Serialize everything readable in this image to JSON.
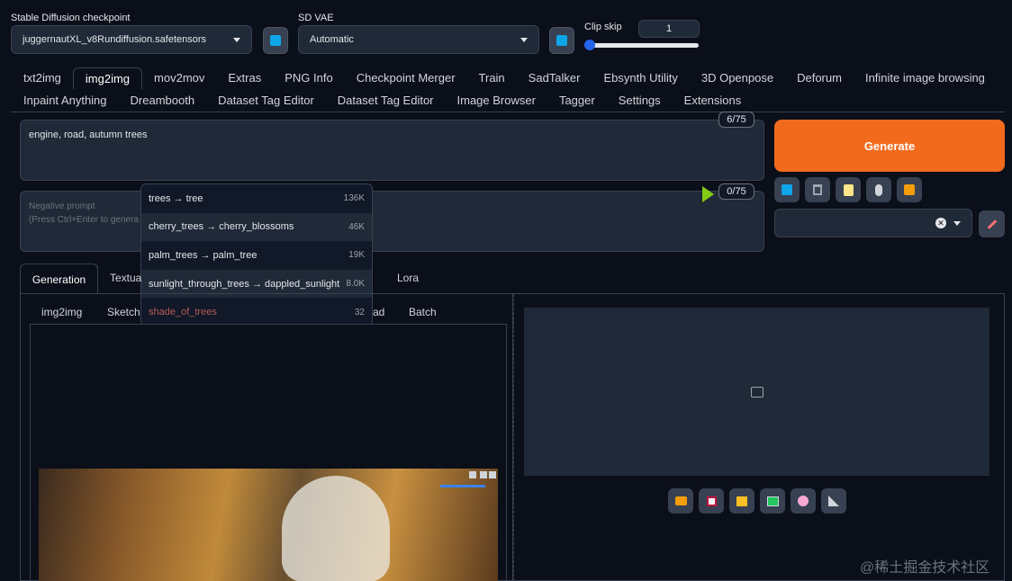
{
  "checkpoint": {
    "label": "Stable Diffusion checkpoint",
    "value": "juggernautXL_v8Rundiffusion.safetensors"
  },
  "vae": {
    "label": "SD VAE",
    "value": "Automatic"
  },
  "clip_skip": {
    "label": "Clip skip",
    "value": "1",
    "level": 0.0
  },
  "tabs_row1": [
    "txt2img",
    "img2img",
    "mov2mov",
    "Extras",
    "PNG Info",
    "Checkpoint Merger",
    "Train",
    "SadTalker",
    "Ebsynth Utility",
    "3D Openpose",
    "Deforum",
    "Infinite image browsing"
  ],
  "tabs_row2": [
    "Inpaint Anything",
    "Dreambooth",
    "Dataset Tag Editor",
    "Dataset Tag Editor",
    "Image Browser",
    "Tagger",
    "Settings",
    "Extensions"
  ],
  "active_tab": "img2img",
  "prompt": {
    "value": "engine, road, autumn trees",
    "counter": "6/75"
  },
  "negative_prompt": {
    "placeholder": "Negative prompt",
    "hint": "(Press Ctrl+Enter to genera",
    "counter": "0/75"
  },
  "autocomplete": [
    {
      "text": "trees → tree",
      "count": "136K"
    },
    {
      "text": "cherry_trees → cherry_blossoms",
      "count": "46K"
    },
    {
      "text": "palm_trees → palm_tree",
      "count": "19K"
    },
    {
      "text": "sunlight_through_trees → dappled_sunlight",
      "count": "8.0K"
    },
    {
      "text": "shade_of_trees",
      "count": "32"
    }
  ],
  "generate_label": "Generate",
  "tool_icons": [
    "arrow-icon",
    "trash-icon",
    "clipboard-icon",
    "hand-icon",
    "box-icon"
  ],
  "section_tabs": [
    "Generation",
    "Textua",
    "Lora"
  ],
  "sub_tabs": [
    "img2img",
    "Sketch",
    "ad",
    "Batch"
  ],
  "output_icons": [
    "folder-icon",
    "save-icon",
    "zip-icon",
    "image-icon",
    "palette-icon",
    "ruler-icon"
  ],
  "watermark": "@稀土掘金技术社区",
  "colors": {
    "generate": "#f26b1d",
    "accent": "#0ea5e9",
    "background": "#0b0f19"
  }
}
